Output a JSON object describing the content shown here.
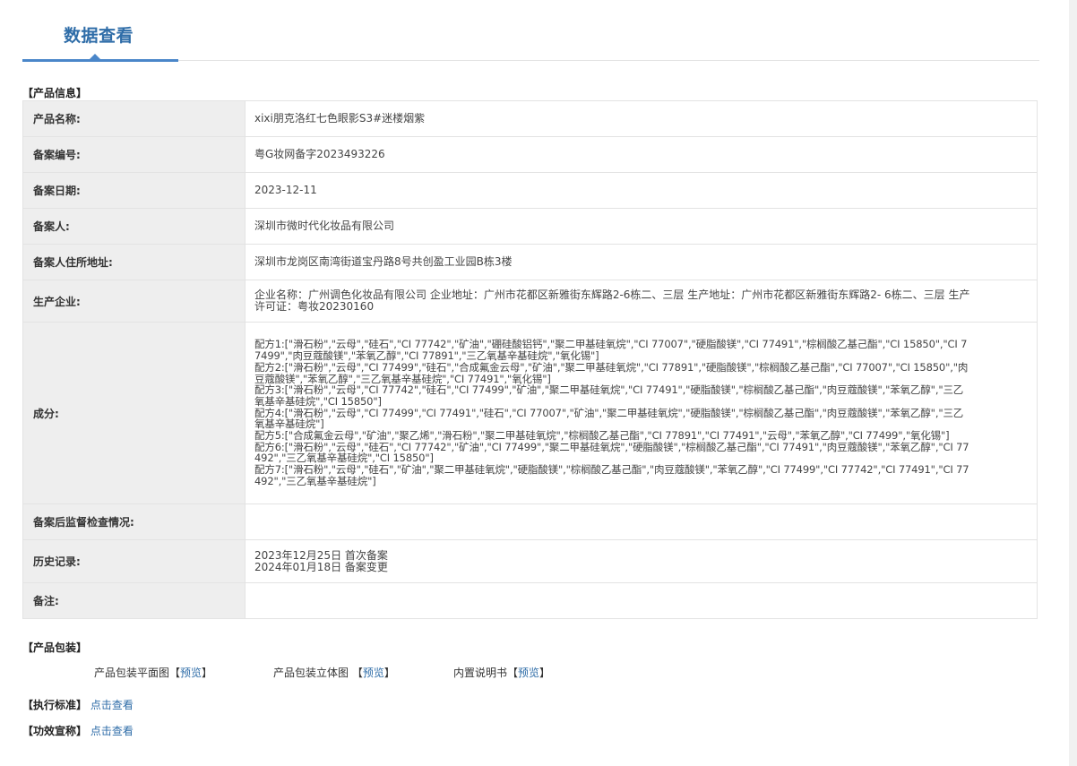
{
  "header": {
    "title": "数据查看"
  },
  "product_info": {
    "section_label": "【产品信息】",
    "rows": [
      {
        "key": "产品名称:",
        "value": "xixi朋克洛红七色眼影S3#迷楼烟紫"
      },
      {
        "key": "备案编号:",
        "value": "粤G妆网备字2023493226"
      },
      {
        "key": "备案日期:",
        "value": "2023-12-11"
      },
      {
        "key": "备案人:",
        "value": "深圳市微时代化妆品有限公司"
      },
      {
        "key": "备案人住所地址:",
        "value": "深圳市龙岗区南湾街道宝丹路8号共创盈工业园B栋3楼"
      },
      {
        "key": "生产企业:",
        "value": "企业名称：广州调色化妆品有限公司 企业地址：广州市花都区新雅街东辉路2-6栋二、三层 生产地址：广州市花都区新雅街东辉路2- 6栋二、三层 生产许可证：粤妆20230160"
      },
      {
        "key": "成分:",
        "value": "配方1:[\"滑石粉\",\"云母\",\"硅石\",\"CI 77742\",\"矿油\",\"硼硅酸铝钙\",\"聚二甲基硅氧烷\",\"CI 77007\",\"硬脂酸镁\",\"CI 77491\",\"棕榈酸乙基己酯\",\"CI 15850\",\"CI 77499\",\"肉豆蔻酸镁\",\"苯氧乙醇\",\"CI 77891\",\"三乙氧基辛基硅烷\",\"氧化锡\"]\n配方2:[\"滑石粉\",\"云母\",\"CI 77499\",\"硅石\",\"合成氟金云母\",\"矿油\",\"聚二甲基硅氧烷\",\"CI 77891\",\"硬脂酸镁\",\"棕榈酸乙基己酯\",\"CI 77007\",\"CI 15850\",\"肉豆蔻酸镁\",\"苯氧乙醇\",\"三乙氧基辛基硅烷\",\"CI 77491\",\"氧化锡\"]\n配方3:[\"滑石粉\",\"云母\",\"CI 77742\",\"硅石\",\"CI 77499\",\"矿油\",\"聚二甲基硅氧烷\",\"CI 77491\",\"硬脂酸镁\",\"棕榈酸乙基己酯\",\"肉豆蔻酸镁\",\"苯氧乙醇\",\"三乙氧基辛基硅烷\",\"CI 15850\"]\n配方4:[\"滑石粉\",\"云母\",\"CI 77499\",\"CI 77491\",\"硅石\",\"CI 77007\",\"矿油\",\"聚二甲基硅氧烷\",\"硬脂酸镁\",\"棕榈酸乙基己酯\",\"肉豆蔻酸镁\",\"苯氧乙醇\",\"三乙氧基辛基硅烷\"]\n配方5:[\"合成氟金云母\",\"矿油\",\"聚乙烯\",\"滑石粉\",\"聚二甲基硅氧烷\",\"棕榈酸乙基己酯\",\"CI 77891\",\"CI 77491\",\"云母\",\"苯氧乙醇\",\"CI 77499\",\"氧化锡\"]\n配方6:[\"滑石粉\",\"云母\",\"硅石\",\"CI 77742\",\"矿油\",\"CI 77499\",\"聚二甲基硅氧烷\",\"硬脂酸镁\",\"棕榈酸乙基己酯\",\"CI 77491\",\"肉豆蔻酸镁\",\"苯氧乙醇\",\"CI 77492\",\"三乙氧基辛基硅烷\",\"CI 15850\"]\n配方7:[\"滑石粉\",\"云母\",\"硅石\",\"矿油\",\"聚二甲基硅氧烷\",\"硬脂酸镁\",\"棕榈酸乙基己酯\",\"肉豆蔻酸镁\",\"苯氧乙醇\",\"CI 77499\",\"CI 77742\",\"CI 77491\",\"CI 77492\",\"三乙氧基辛基硅烷\"]"
      },
      {
        "key": "备案后监督检查情况:",
        "value": ""
      },
      {
        "key": "历史记录:",
        "value": "2023年12月25日 首次备案\n2024年01月18日 备案变更"
      },
      {
        "key": "备注:",
        "value": ""
      }
    ]
  },
  "packaging": {
    "section_label": "【产品包装】",
    "items": [
      {
        "label": "产品包装平面图【",
        "link": "预览",
        "suffix": "】"
      },
      {
        "label": "产品包装立体图 【",
        "link": "预览",
        "suffix": "】"
      },
      {
        "label": "内置说明书【",
        "link": "预览",
        "suffix": "】"
      }
    ]
  },
  "standard": {
    "label": "【执行标准】",
    "link": "点击查看"
  },
  "efficacy": {
    "label": "【功效宣称】",
    "link": "点击查看"
  },
  "colors": {
    "accent": "#2f6da8",
    "table_border": "#a9c3e2",
    "key_bg": "#eeeeee"
  }
}
